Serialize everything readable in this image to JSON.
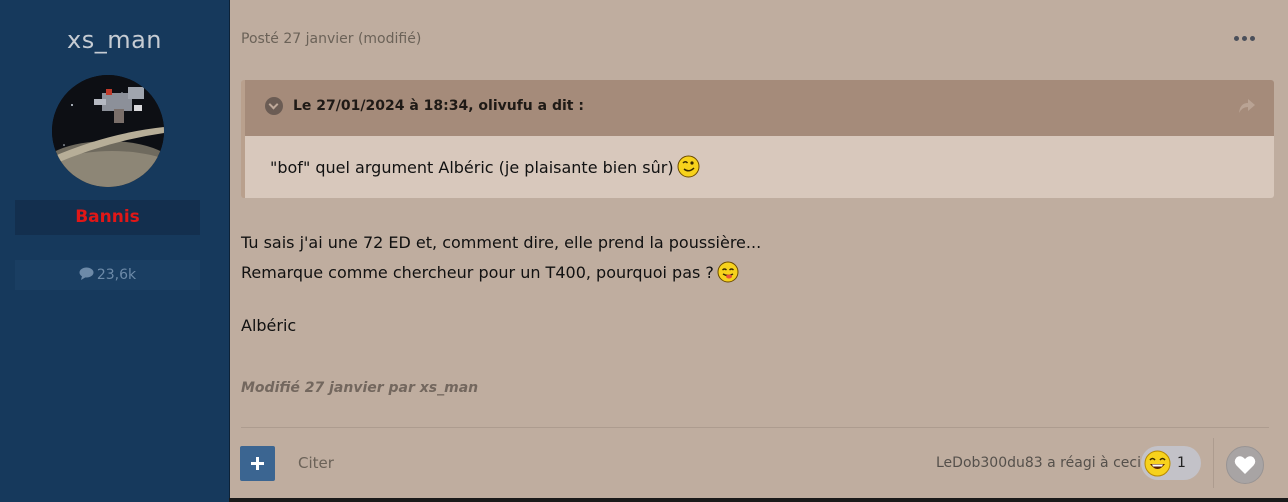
{
  "author": {
    "name": "xs_man",
    "group": "Bannis",
    "post_count": "23,6k",
    "group_color": "#e01717"
  },
  "post": {
    "meta": "Posté 27 janvier (modifié)",
    "quote": {
      "citation": "Le 27/01/2024 à 18:34, olivufu a dit :",
      "text": "\"bof\"  quel argument Albéric (je plaisante bien sûr)",
      "smiley": "wink-smiley-icon"
    },
    "body": {
      "line1": "Tu sais j'ai une 72 ED et, comment dire,  elle prend la poussière...",
      "line2": "Remarque comme chercheur pour un T400, pourquoi pas ?",
      "signature": "Albéric"
    },
    "edited_note": "Modifié 27 janvier par xs_man"
  },
  "footer": {
    "quote_label": "Citer",
    "reacted_text": "LeDob300du83 a réagi à ceci",
    "reaction": {
      "icon": "laugh-emoji-icon",
      "count": "1"
    }
  },
  "colors": {
    "page_bg": "#bfad9f",
    "sidebar_bg": "#16395c",
    "accent_button": "#3b6591"
  }
}
